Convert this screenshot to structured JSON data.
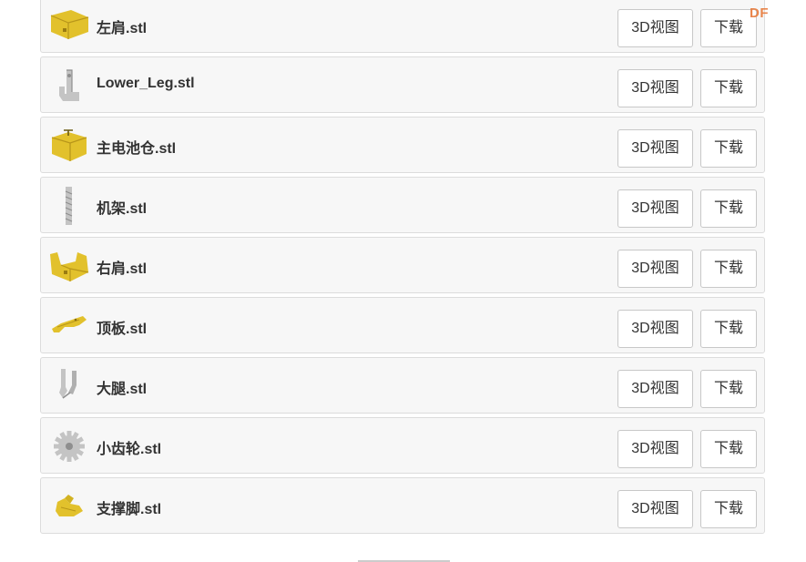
{
  "files": [
    {
      "name": "左肩.stl",
      "icon": "left-shoulder-part-icon",
      "color": "#e2c12c"
    },
    {
      "name": "Lower_Leg.stl",
      "icon": "lower-leg-part-icon",
      "color": "#c4c4c4"
    },
    {
      "name": "主电池仓.stl",
      "icon": "battery-case-part-icon",
      "color": "#e2c12c"
    },
    {
      "name": "机架.stl",
      "icon": "frame-part-icon",
      "color": "#c4c4c4"
    },
    {
      "name": "右肩.stl",
      "icon": "right-shoulder-part-icon",
      "color": "#e2c12c"
    },
    {
      "name": "顶板.stl",
      "icon": "top-plate-part-icon",
      "color": "#e2c12c"
    },
    {
      "name": "大腿.stl",
      "icon": "thigh-part-icon",
      "color": "#c4c4c4"
    },
    {
      "name": "小齿轮.stl",
      "icon": "small-gear-part-icon",
      "color": "#c4c4c4"
    },
    {
      "name": "支撑脚.stl",
      "icon": "support-foot-part-icon",
      "color": "#e2c12c"
    }
  ],
  "buttons": {
    "view_3d_label": "3D视图",
    "download_label": "下载"
  },
  "watermark": {
    "text": "DF",
    "color": "#e87a3a"
  }
}
